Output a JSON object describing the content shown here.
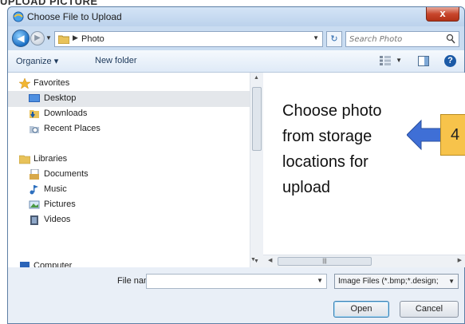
{
  "page_heading": "UPLOAD PICTURE",
  "window": {
    "title": "Choose File to Upload",
    "close_label": "x"
  },
  "address": {
    "path": "Photo",
    "search_placeholder": "Search Photo"
  },
  "toolbar": {
    "organize_label": "Organize ▾",
    "new_folder_label": "New folder"
  },
  "nav": {
    "favorites_label": "Favorites",
    "desktop_label": "Desktop",
    "downloads_label": "Downloads",
    "recent_label": "Recent Places",
    "libraries_label": "Libraries",
    "documents_label": "Documents",
    "music_label": "Music",
    "pictures_label": "Pictures",
    "videos_label": "Videos",
    "computer_label": "Computer"
  },
  "annotation": {
    "text": "Choose photo from storage locations for upload",
    "step": "4"
  },
  "bottom": {
    "file_name_label": "File name:",
    "file_name_value": "",
    "file_type_selected": "Image Files (*.bmp;*.design;",
    "open_label": "Open",
    "cancel_label": "Cancel"
  },
  "colors": {
    "accent": "#1c5aa6",
    "badge": "#f7c34b",
    "arrow": "#3f6fd6"
  }
}
